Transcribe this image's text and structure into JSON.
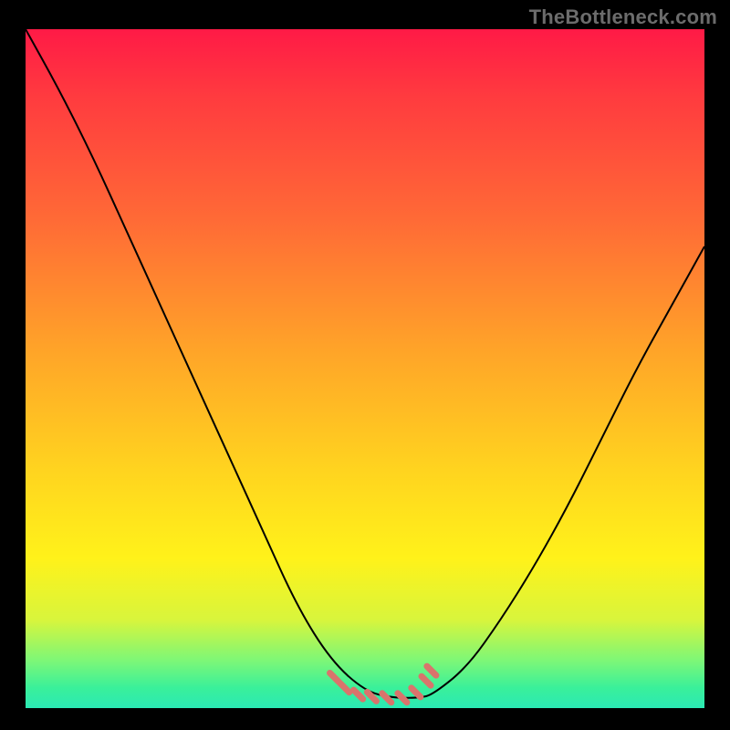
{
  "watermark": "TheBottleneck.com",
  "chart_data": {
    "type": "line",
    "title": "",
    "xlabel": "",
    "ylabel": "",
    "xlim": [
      0,
      1
    ],
    "ylim": [
      0,
      1
    ],
    "grid": false,
    "legend": false,
    "note": "Unlabeled bottleneck curve chart. Axes carry no visible tick labels or units; values below are normalized 0–1 within the plot box, estimated from pixel positions. y=1 is top edge (red), y=0 is bottom edge (green). The curve is a V-shape with a flat minimum near the bottom; salmon-colored markers sit on the flat minimum segment.",
    "series": [
      {
        "name": "bottleneck-curve",
        "x": [
          0.0,
          0.05,
          0.1,
          0.15,
          0.2,
          0.25,
          0.3,
          0.35,
          0.4,
          0.45,
          0.5,
          0.54,
          0.58,
          0.6,
          0.65,
          0.7,
          0.75,
          0.8,
          0.85,
          0.9,
          0.95,
          1.0
        ],
        "y": [
          1.0,
          0.91,
          0.81,
          0.7,
          0.59,
          0.48,
          0.37,
          0.26,
          0.15,
          0.07,
          0.025,
          0.015,
          0.015,
          0.02,
          0.06,
          0.13,
          0.21,
          0.3,
          0.4,
          0.5,
          0.59,
          0.68
        ]
      }
    ],
    "markers": {
      "name": "flat-minimum-dots",
      "color": "#d9746c",
      "points_xy": [
        [
          0.455,
          0.045
        ],
        [
          0.47,
          0.03
        ],
        [
          0.49,
          0.02
        ],
        [
          0.51,
          0.017
        ],
        [
          0.532,
          0.015
        ],
        [
          0.555,
          0.015
        ],
        [
          0.575,
          0.023
        ],
        [
          0.59,
          0.04
        ],
        [
          0.598,
          0.055
        ]
      ]
    },
    "gradient_stops": [
      {
        "pos": 0.0,
        "color": "#ff1a46"
      },
      {
        "pos": 0.28,
        "color": "#ff6a36"
      },
      {
        "pos": 0.65,
        "color": "#ffd41f"
      },
      {
        "pos": 0.87,
        "color": "#d8f53c"
      },
      {
        "pos": 1.0,
        "color": "#2be9b4"
      }
    ]
  }
}
